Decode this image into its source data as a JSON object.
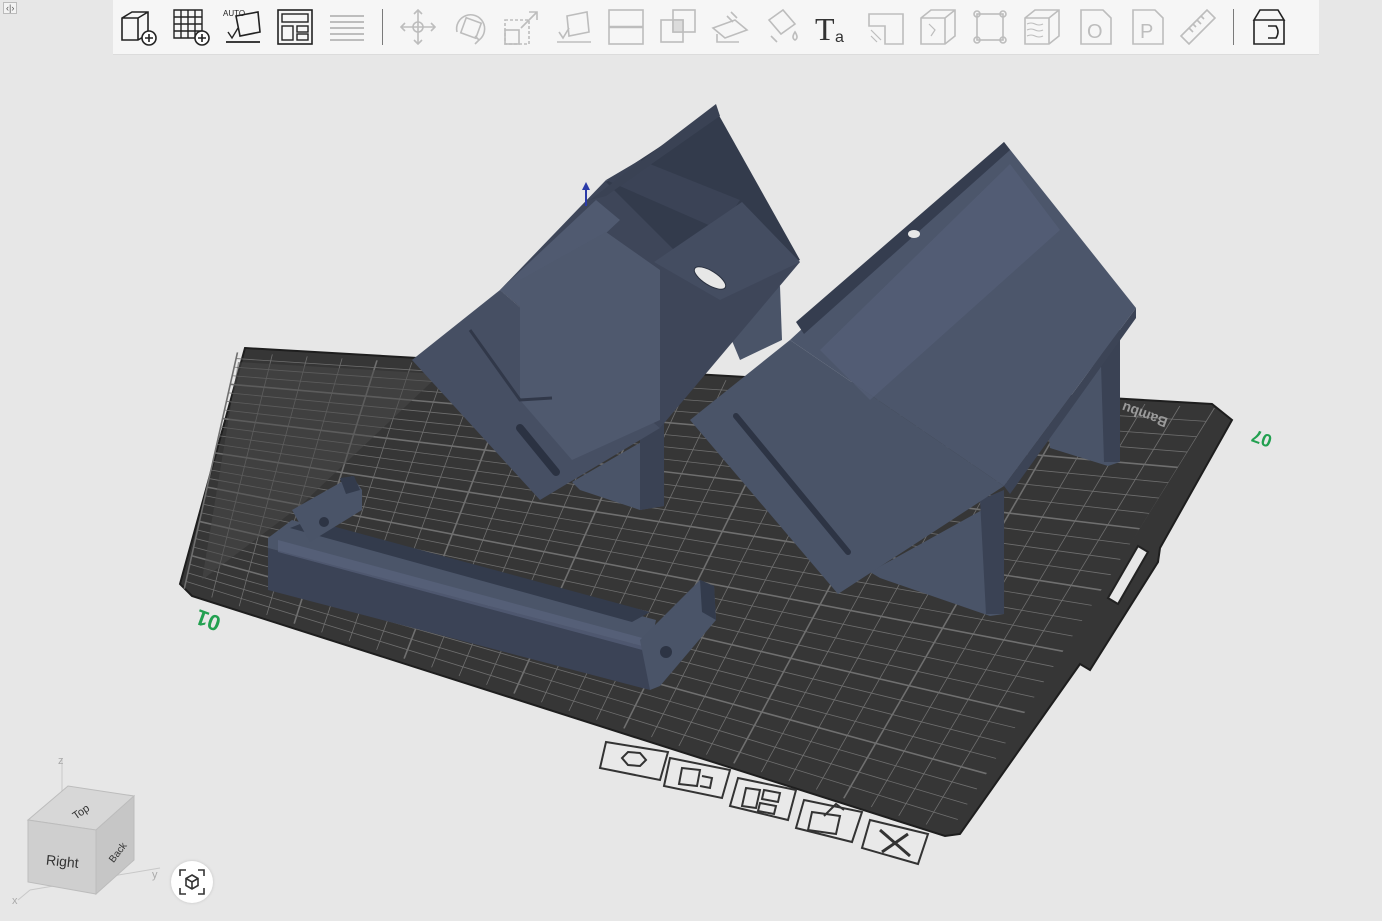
{
  "toolbar": {
    "groups": [
      [
        {
          "name": "add-object",
          "icon": "cube-plus-icon",
          "enabled": true
        },
        {
          "name": "add-plate",
          "icon": "grid-plus-icon",
          "enabled": true
        },
        {
          "name": "auto-orient",
          "icon": "auto-orient-icon",
          "label": "AUTO",
          "enabled": true
        },
        {
          "name": "arrange",
          "icon": "arrange-icon",
          "enabled": true
        },
        {
          "name": "split-layers",
          "icon": "layers-icon",
          "enabled": false
        }
      ],
      [
        {
          "name": "move",
          "icon": "move-icon",
          "enabled": false
        },
        {
          "name": "rotate",
          "icon": "rotate-icon",
          "enabled": false
        },
        {
          "name": "scale",
          "icon": "scale-icon",
          "enabled": false
        },
        {
          "name": "lay-on-face",
          "icon": "lay-on-face-icon",
          "enabled": false
        },
        {
          "name": "cut",
          "icon": "cut-icon",
          "enabled": false
        },
        {
          "name": "boolean",
          "icon": "boolean-icon",
          "enabled": false
        },
        {
          "name": "support-paint",
          "icon": "support-paint-icon",
          "enabled": false
        },
        {
          "name": "color-paint",
          "icon": "color-paint-icon",
          "enabled": false
        },
        {
          "name": "text",
          "icon": "text-icon",
          "label": "Ta",
          "enabled": true
        },
        {
          "name": "seam-paint",
          "icon": "seam-paint-icon",
          "enabled": false
        },
        {
          "name": "emboss",
          "icon": "emboss-icon",
          "enabled": false
        },
        {
          "name": "mesh-boolean",
          "icon": "fit-frame-icon",
          "enabled": false
        },
        {
          "name": "fuzzy-skin",
          "icon": "fuzzy-skin-icon",
          "enabled": false
        },
        {
          "name": "brim-ears",
          "icon": "brim-o-icon",
          "label": "O",
          "enabled": false
        },
        {
          "name": "prime-tower",
          "icon": "brim-p-icon",
          "label": "P",
          "enabled": false
        },
        {
          "name": "measure",
          "icon": "ruler-icon",
          "enabled": false
        }
      ],
      [
        {
          "name": "assembly-view",
          "icon": "assembly-icon",
          "enabled": true
        }
      ]
    ]
  },
  "corner_toggle": "‹|›",
  "plate": {
    "label_front": "01",
    "label_right": "07",
    "brand_text": "Bambu",
    "colors": {
      "background": "#e7e7e7",
      "plate": "#363636",
      "plate_border": "#1e1e1e",
      "grid": "#6b6b6b",
      "model": "#4a5468",
      "model_dark": "#333b4c",
      "model_light": "#5b6680",
      "axis_label": "#22a050"
    },
    "tools": [
      {
        "name": "plate-settings",
        "icon": "gear-icon"
      },
      {
        "name": "auto-orient-plate",
        "icon": "orient-icon"
      },
      {
        "name": "arrange-plate",
        "icon": "arrange-icon"
      },
      {
        "name": "edit-plate",
        "icon": "pencil-icon"
      },
      {
        "name": "delete-plate",
        "icon": "delete-icon"
      }
    ]
  },
  "view_cube": {
    "faces": {
      "top": "Top",
      "right": "Right",
      "back": "Back"
    },
    "axes": {
      "x": "x",
      "y": "y",
      "z": "z"
    }
  },
  "reset_view": {
    "icon": "reset-view-icon"
  }
}
